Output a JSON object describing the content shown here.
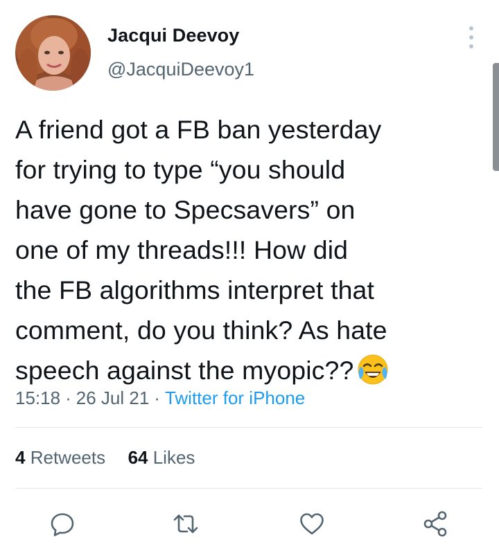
{
  "author": {
    "display_name": "Jacqui Deevoy",
    "handle": "@JacquiDeevoy1"
  },
  "tweet": {
    "lines": [
      "A friend got a FB ban yesterday",
      "for trying to type “you should",
      "have gone to Specsavers” on",
      "one of my threads!!! How did",
      "the FB algorithms interpret that",
      "comment, do you think? As hate",
      "speech against the myopic??"
    ],
    "emoji": "face-with-tears-of-joy",
    "time": "15:18",
    "date": "26 Jul 21",
    "separator": "·",
    "source": "Twitter for iPhone"
  },
  "stats": {
    "retweets_count": "4",
    "retweets_label": "Retweets",
    "likes_count": "64",
    "likes_label": "Likes"
  },
  "actions": [
    "reply-icon",
    "retweet-icon",
    "like-icon",
    "share-icon"
  ],
  "colors": {
    "text": "#0f1419",
    "secondary": "#536471",
    "link": "#1d9bf0",
    "divider": "#e1e6ea"
  }
}
